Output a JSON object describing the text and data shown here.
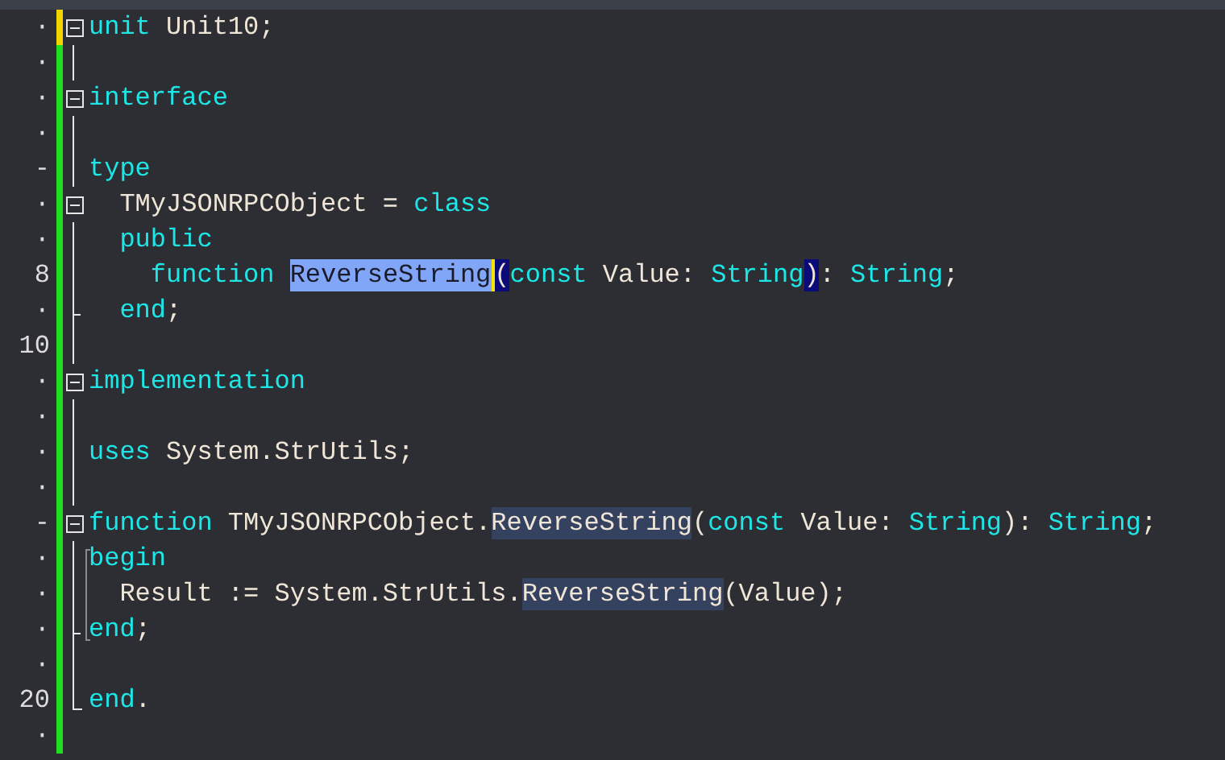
{
  "editor": {
    "lines": [
      {
        "gutter": "·",
        "modified": true,
        "fold": {
          "kind": "box"
        },
        "tokens": [
          {
            "kind": "kw",
            "text": "unit"
          },
          {
            "kind": "id",
            "text": " Unit10;"
          }
        ]
      },
      {
        "gutter": "·",
        "modified": false,
        "fold": {
          "kind": "line"
        }
      },
      {
        "gutter": "·",
        "modified": false,
        "fold": {
          "kind": "box"
        },
        "tokens": [
          {
            "kind": "kw",
            "text": "interface"
          }
        ]
      },
      {
        "gutter": "·",
        "modified": false,
        "fold": {
          "kind": "line"
        }
      },
      {
        "gutter": "-",
        "modified": false,
        "fold": {
          "kind": "line"
        },
        "tokens": [
          {
            "kind": "kw",
            "text": "type"
          }
        ]
      },
      {
        "gutter": "·",
        "modified": false,
        "fold": {
          "kind": "box"
        },
        "tokens": [
          {
            "kind": "id",
            "text": "  TMyJSONRPCObject = "
          },
          {
            "kind": "kw",
            "text": "class"
          }
        ]
      },
      {
        "gutter": "·",
        "modified": false,
        "fold": {
          "kind": "line"
        },
        "tokens": [
          {
            "kind": "kw",
            "text": "  public"
          }
        ]
      },
      {
        "gutter": "8",
        "modified": false,
        "fold": {
          "kind": "line"
        },
        "tokens": [
          {
            "kind": "kw",
            "text": "    function "
          },
          {
            "kind": "selected",
            "text": "ReverseString"
          },
          {
            "kind": "caret"
          },
          {
            "kind": "brace",
            "text": "("
          },
          {
            "kind": "kw",
            "text": "const"
          },
          {
            "kind": "id",
            "text": " Value: "
          },
          {
            "kind": "kw",
            "text": "String"
          },
          {
            "kind": "brace",
            "text": ")"
          },
          {
            "kind": "id",
            "text": ": "
          },
          {
            "kind": "kw",
            "text": "String"
          },
          {
            "kind": "id",
            "text": ";"
          }
        ]
      },
      {
        "gutter": "·",
        "modified": false,
        "fold": {
          "kind": "branch"
        },
        "tokens": [
          {
            "kind": "kw",
            "text": "  end"
          },
          {
            "kind": "id",
            "text": ";"
          }
        ]
      },
      {
        "gutter": "10",
        "modified": false,
        "fold": {
          "kind": "line"
        }
      },
      {
        "gutter": "·",
        "modified": false,
        "fold": {
          "kind": "box"
        },
        "tokens": [
          {
            "kind": "kw",
            "text": "implementation"
          }
        ]
      },
      {
        "gutter": "·",
        "modified": false,
        "fold": {
          "kind": "line"
        }
      },
      {
        "gutter": "·",
        "modified": false,
        "fold": {
          "kind": "line"
        },
        "tokens": [
          {
            "kind": "kw",
            "text": "uses"
          },
          {
            "kind": "id",
            "text": " System.StrUtils;"
          }
        ]
      },
      {
        "gutter": "·",
        "modified": false,
        "fold": {
          "kind": "line"
        }
      },
      {
        "gutter": "-",
        "modified": false,
        "fold": {
          "kind": "box"
        },
        "tokens": [
          {
            "kind": "kw",
            "text": "function"
          },
          {
            "kind": "id",
            "text": " TMyJSONRPCObject."
          },
          {
            "kind": "ref",
            "text": "ReverseString"
          },
          {
            "kind": "id",
            "text": "("
          },
          {
            "kind": "kw",
            "text": "const"
          },
          {
            "kind": "id",
            "text": " Value: "
          },
          {
            "kind": "kw",
            "text": "String"
          },
          {
            "kind": "id",
            "text": "): "
          },
          {
            "kind": "kw",
            "text": "String"
          },
          {
            "kind": "id",
            "text": ";"
          }
        ]
      },
      {
        "gutter": "·",
        "modified": false,
        "fold": {
          "kind": "line"
        },
        "block": {
          "kind": "start"
        },
        "tokens": [
          {
            "kind": "kw",
            "text": "begin"
          }
        ]
      },
      {
        "gutter": "·",
        "modified": false,
        "fold": {
          "kind": "line"
        },
        "block": {
          "kind": "middle"
        },
        "tokens": [
          {
            "kind": "id",
            "text": "  Result := System.StrUtils."
          },
          {
            "kind": "ref",
            "text": "ReverseString"
          },
          {
            "kind": "id",
            "text": "(Value);"
          }
        ]
      },
      {
        "gutter": "·",
        "modified": false,
        "fold": {
          "kind": "branch"
        },
        "block": {
          "kind": "end"
        },
        "tokens": [
          {
            "kind": "kw",
            "text": "end"
          },
          {
            "kind": "id",
            "text": ";"
          }
        ]
      },
      {
        "gutter": "·",
        "modified": false,
        "fold": {
          "kind": "line"
        }
      },
      {
        "gutter": "20",
        "modified": false,
        "fold": {
          "kind": "end"
        },
        "tokens": [
          {
            "kind": "kw",
            "text": "end"
          },
          {
            "kind": "id",
            "text": "."
          }
        ]
      },
      {
        "gutter": "·",
        "modified": false
      }
    ]
  }
}
